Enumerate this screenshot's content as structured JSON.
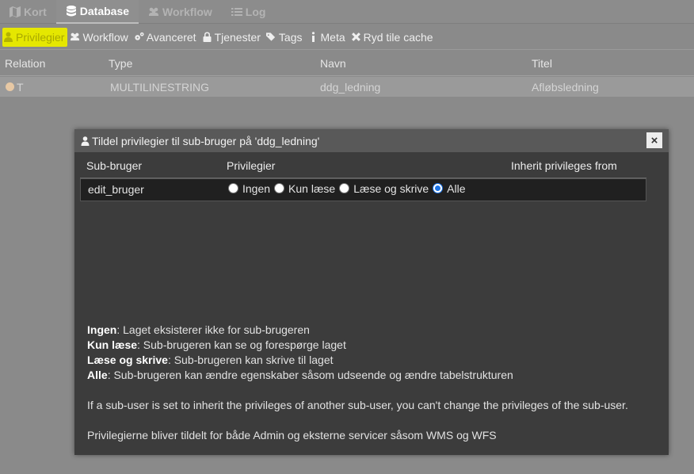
{
  "top_tabs": [
    {
      "label": "Kort",
      "icon": "map-icon"
    },
    {
      "label": "Database",
      "icon": "database-icon"
    },
    {
      "label": "Workflow",
      "icon": "users-icon"
    },
    {
      "label": "Log",
      "icon": "list-icon"
    }
  ],
  "sub_tabs": [
    {
      "label": "Privilegier",
      "icon": "user-icon"
    },
    {
      "label": "Workflow",
      "icon": "users-icon"
    },
    {
      "label": "Avanceret",
      "icon": "gears-icon"
    },
    {
      "label": "Tjenester",
      "icon": "lock-icon"
    },
    {
      "label": "Tags",
      "icon": "tags-icon"
    },
    {
      "label": "Meta",
      "icon": "info-icon"
    },
    {
      "label": "Ryd tile cache",
      "icon": "close-icon"
    }
  ],
  "table": {
    "headers": [
      "Relation",
      "Type",
      "Navn",
      "Titel"
    ],
    "rows": [
      {
        "relation": "T",
        "type": "MULTILINESTRING",
        "navn": "ddg_ledning",
        "titel": "Afløbsledning"
      }
    ]
  },
  "modal": {
    "title": "Tildel privilegier til sub-bruger på 'ddg_ledning'",
    "close_label": "×",
    "headers": {
      "user": "Sub-bruger",
      "privileges": "Privilegier",
      "inherit": "Inherit privileges from"
    },
    "row": {
      "user": "edit_bruger",
      "options": [
        "Ingen",
        "Kun læse",
        "Læse og skrive",
        "Alle"
      ],
      "selected": "Alle"
    },
    "help": [
      {
        "term": "Ingen",
        "text": ": Laget eksisterer ikke for sub-brugeren"
      },
      {
        "term": "Kun læse",
        "text": ": Sub-brugeren kan se og forespørge laget"
      },
      {
        "term": "Læse og skrive",
        "text": ": Sub-brugeren kan skrive til laget"
      },
      {
        "term": "Alle",
        "text": ": Sub-brugeren kan ændre egenskaber såsom udseende og ændre tabelstrukturen"
      }
    ],
    "note_inherit": "If a sub-user is set to inherit the privileges of another sub-user, you can't change the privileges of the sub-user.",
    "note_services": "Privilegierne bliver tildelt for både Admin og eksterne servicer såsom WMS og WFS"
  },
  "colors": {
    "highlight": "#e5e700",
    "radio_selected": "#1a73e8",
    "modal_bg": "#3c3c3c"
  }
}
